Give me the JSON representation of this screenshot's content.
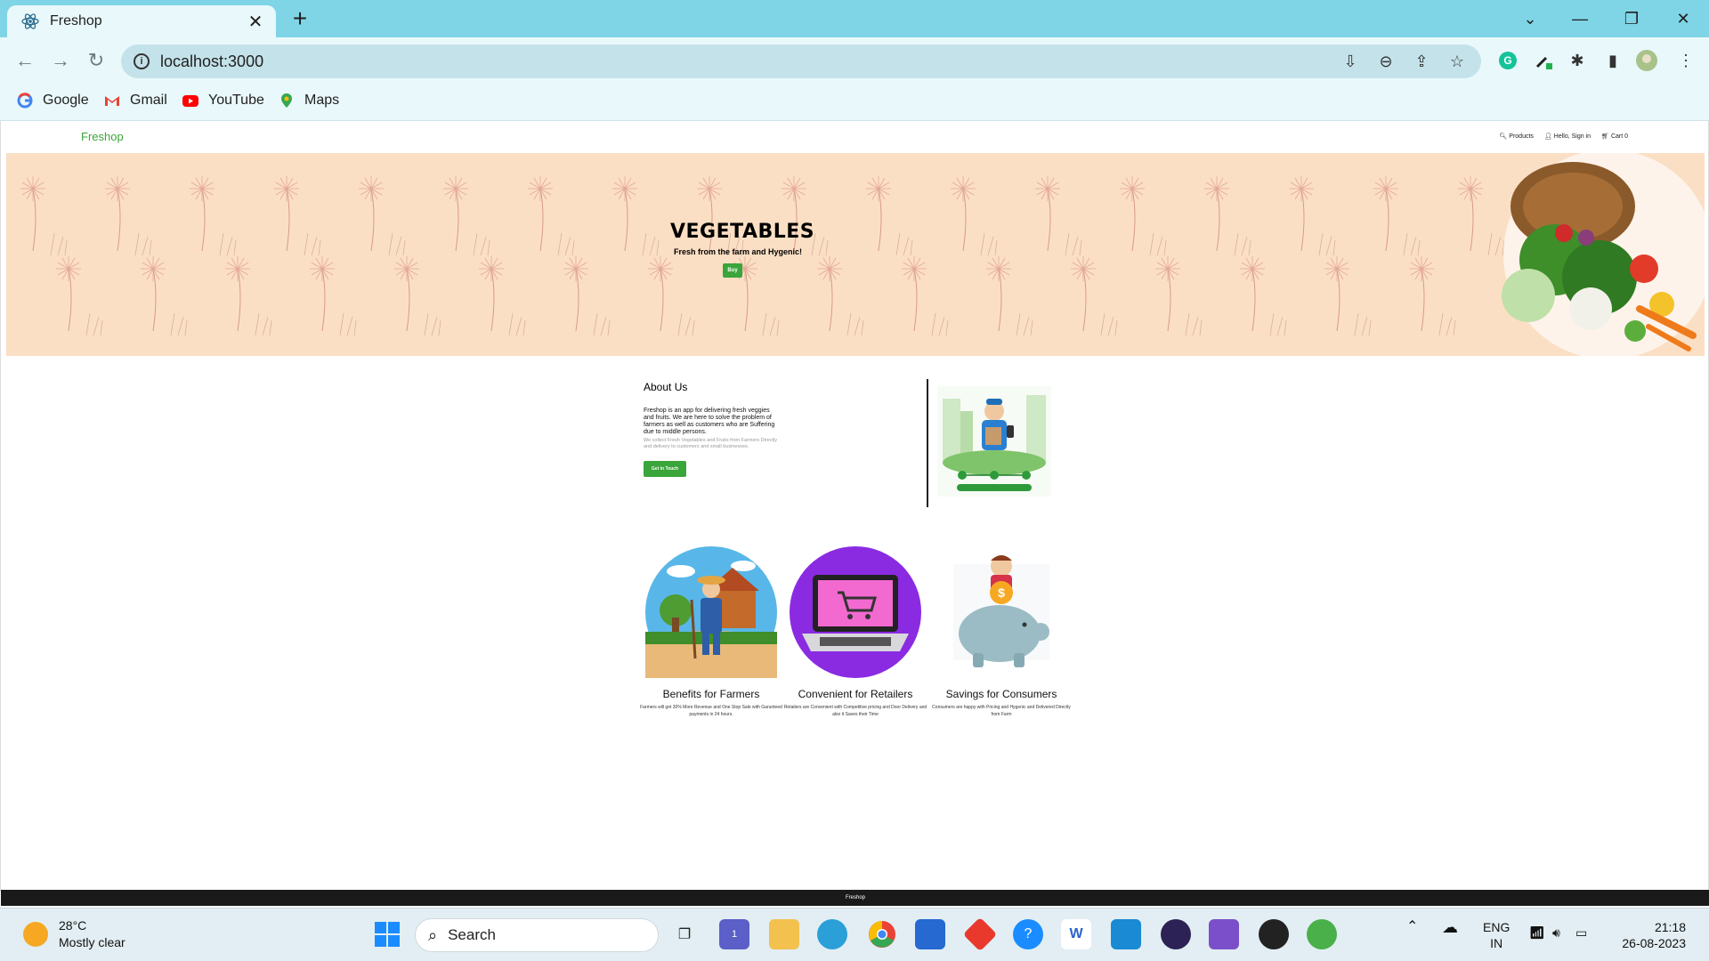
{
  "browser": {
    "tab_title": "Freshop",
    "url": "localhost:3000",
    "bookmarks": [
      {
        "label": "Google",
        "icon": "google-icon"
      },
      {
        "label": "Gmail",
        "icon": "gmail-icon"
      },
      {
        "label": "YouTube",
        "icon": "youtube-icon"
      },
      {
        "label": "Maps",
        "icon": "maps-icon"
      }
    ]
  },
  "site": {
    "brand": "Freshop",
    "nav": {
      "products": "Products",
      "signin": "Hello, Sign in",
      "cart": "Cart 0"
    },
    "hero": {
      "title": "VEGETABLES",
      "subtitle": "Fresh from the farm and Hygenic!",
      "button": "Buy"
    },
    "about": {
      "title": "About Us",
      "p1": "Freshop is an app for delivering fresh veggies and fruits. We are here to solve the problem of farmers as well as customers who are Suffering due to middle persons.",
      "p2": "We collect Fresh Vegetables and Fruits from Farmers Directly and delivery to customers and small businesses.",
      "button": "Get in Touch"
    },
    "features": [
      {
        "title": "Benefits for Farmers",
        "desc": "Farmers will get 30% More Revenue and One Stop Sale with Garunteed payments in 24 hours."
      },
      {
        "title": "Convenient for Retailers",
        "desc": "Retailers are Convenient with Competitive pricing and Door Delivery and also it Saves their Time"
      },
      {
        "title": "Savings for Consumers",
        "desc": "Consumers are happy with Pricing and Hygenic and Delivered Directly from Farm"
      }
    ],
    "footer": "Freshop"
  },
  "taskbar": {
    "weather_temp": "28°C",
    "weather_desc": "Mostly clear",
    "search_placeholder": "Search",
    "lang_top": "ENG",
    "lang_bottom": "IN",
    "time": "21:18",
    "date": "26-08-2023",
    "chat_badge": "1"
  },
  "colors": {
    "accent_green": "#3aa53a",
    "tabbar": "#7fd5e6",
    "hero_bg": "#fbdfc4"
  }
}
